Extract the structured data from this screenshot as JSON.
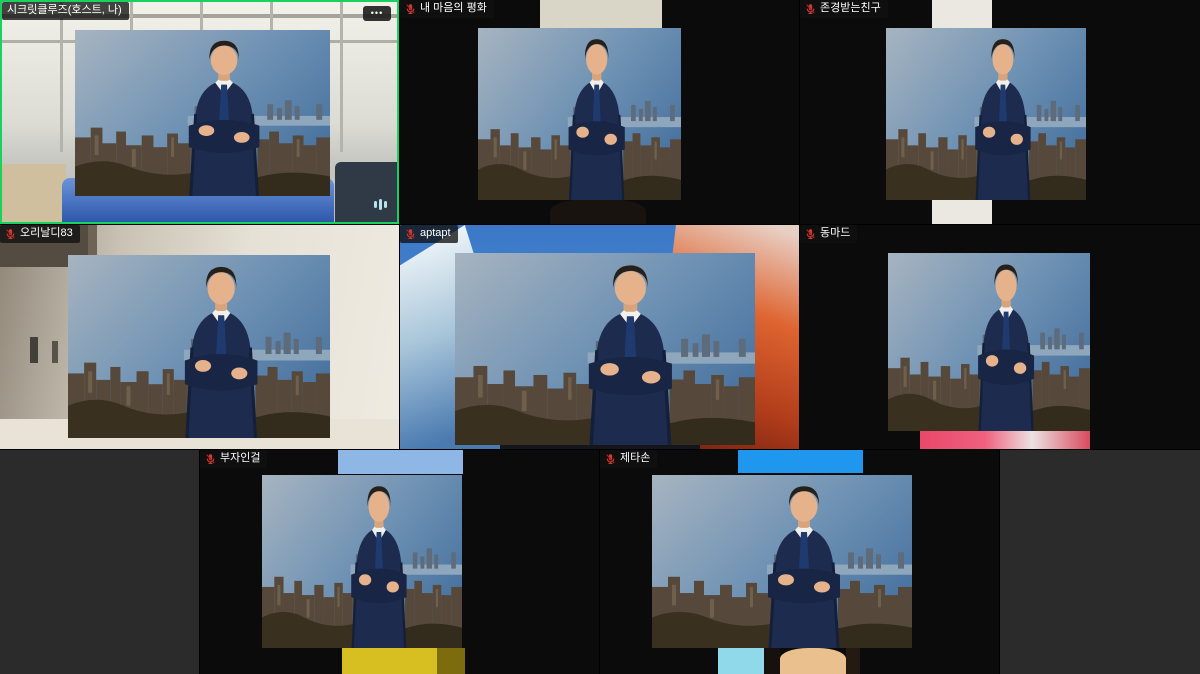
{
  "app": {
    "name": "video-conference-gallery-view",
    "view": "gallery"
  },
  "colors": {
    "active_speaker_border": "#17d25c",
    "muted_mic_icon": "#d43a34",
    "audio_indicator": "#b9e2ec",
    "name_tag_background": "rgba(17,17,17,0.78)",
    "page_background": "#000000",
    "empty_strip": "#2b2b2b"
  },
  "ui": {
    "more_label": "•••"
  },
  "participants": [
    {
      "name": "시크릿클루즈(호스트, 나)",
      "muted": false,
      "active_speaker": true,
      "audio_playing": true,
      "has_more_menu": true
    },
    {
      "name": "내 마음의 평화",
      "muted": true,
      "active_speaker": false,
      "audio_playing": false,
      "has_more_menu": false
    },
    {
      "name": "존경받는친구",
      "muted": true,
      "active_speaker": false,
      "audio_playing": false,
      "has_more_menu": false
    },
    {
      "name": "오리날디83",
      "muted": true,
      "active_speaker": false,
      "audio_playing": false,
      "has_more_menu": false
    },
    {
      "name": "aptapt",
      "muted": true,
      "active_speaker": false,
      "audio_playing": false,
      "has_more_menu": false
    },
    {
      "name": "동마드",
      "muted": true,
      "active_speaker": false,
      "audio_playing": false,
      "has_more_menu": false
    },
    {
      "name": "부자인걸",
      "muted": true,
      "active_speaker": false,
      "audio_playing": false,
      "has_more_menu": false
    },
    {
      "name": "제타손",
      "muted": true,
      "active_speaker": false,
      "audio_playing": false,
      "has_more_menu": false
    }
  ]
}
